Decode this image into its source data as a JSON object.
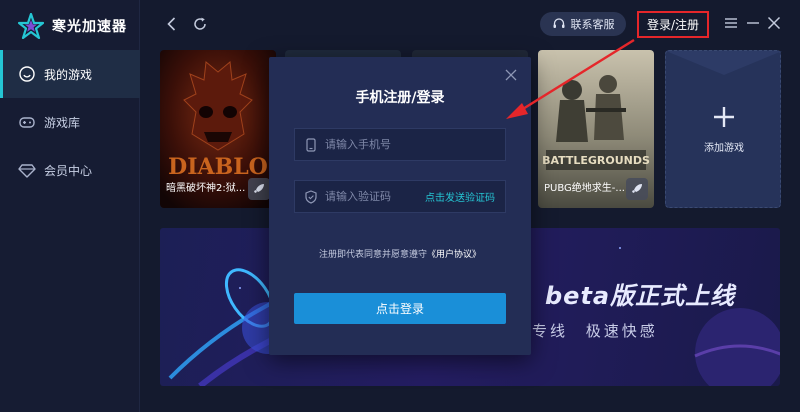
{
  "app": {
    "name": "寒光加速器"
  },
  "sidebar": {
    "items": [
      {
        "label": "我的游戏",
        "icon": "smiley-icon",
        "active": true
      },
      {
        "label": "游戏库",
        "icon": "gamepad-icon",
        "active": false
      },
      {
        "label": "会员中心",
        "icon": "diamond-icon",
        "active": false
      }
    ]
  },
  "header": {
    "support_label": "联系客服",
    "login_label": "登录/注册"
  },
  "games": [
    {
      "name": "暗黑破坏神2:狱...",
      "icon": "rocket-icon"
    },
    {
      "name": "PUBG绝地求生-...",
      "icon": "rocket-icon"
    }
  ],
  "add_game": {
    "label": "添加游戏"
  },
  "banner": {
    "title": "beta版正式上线",
    "subtitle": "专线  极速快感"
  },
  "modal": {
    "title": "手机注册/登录",
    "phone_placeholder": "请输入手机号",
    "code_placeholder": "请输入验证码",
    "send_code_label": "点击发送验证码",
    "agreement_prefix": "注册即代表同意并愿意遵守",
    "agreement_link": "《用户协议》",
    "submit_label": "点击登录"
  },
  "colors": {
    "accent": "#25c6d4",
    "primary_button": "#1a8fd8",
    "annotation_red": "#e5262a",
    "background": "#141a2e"
  }
}
